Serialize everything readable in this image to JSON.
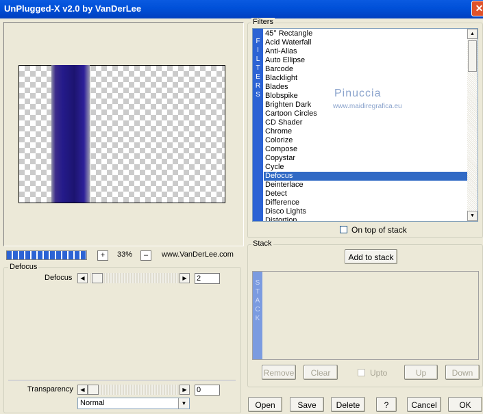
{
  "window": {
    "title": "UnPlugged-X v2.0 by VanDerLee",
    "close_glyph": "✕"
  },
  "zoom": {
    "plus": "+",
    "value": "33%",
    "minus": "–",
    "website": "www.VanDerLee.com",
    "progress": 1.0
  },
  "params": {
    "group_label": "Defocus",
    "slider_label": "Defocus",
    "slider_value": "2",
    "left_arrow": "◀",
    "right_arrow": "▶"
  },
  "transparency": {
    "label": "Transparency",
    "value": "0",
    "blend_mode": "Normal",
    "combo_arrow": "▼"
  },
  "filters": {
    "group_label": "Filters",
    "strip_letters": [
      "F",
      "I",
      "L",
      "T",
      "E",
      "R",
      "S"
    ],
    "items": [
      "45° Rectangle",
      "Acid Waterfall",
      "Anti-Alias",
      "Auto Ellipse",
      "Barcode",
      "Blacklight",
      "Blades",
      "Blobspike",
      "Brighten Dark",
      "Cartoon Circles",
      "CD Shader",
      "Chrome",
      "Colorize",
      "Compose",
      "Copystar",
      "Cycle",
      "Defocus",
      "Deinterlace",
      "Detect",
      "Difference",
      "Disco Lights",
      "Distortion"
    ],
    "selected_index": 16,
    "on_top_label": "On top of stack",
    "scroll_up": "▲",
    "scroll_down": "▼"
  },
  "watermark": {
    "name": "Pinuccia",
    "url": "www.maidiregrafica.eu"
  },
  "stack": {
    "group_label": "Stack",
    "add_label": "Add to stack",
    "strip_letters": [
      "S",
      "T",
      "A",
      "C",
      "K"
    ],
    "remove_label": "Remove",
    "clear_label": "Clear",
    "upto_label": "Upto",
    "up_label": "Up",
    "down_label": "Down"
  },
  "bottom_buttons": {
    "open": "Open",
    "save": "Save",
    "delete": "Delete",
    "help": "?",
    "cancel": "Cancel",
    "ok": "OK"
  },
  "colors": {
    "titlebar": "#0054e3",
    "selection": "#316ac5",
    "filters_strip": "#2c63d4",
    "stack_strip": "#7b9be0",
    "band": "#241a8a"
  }
}
